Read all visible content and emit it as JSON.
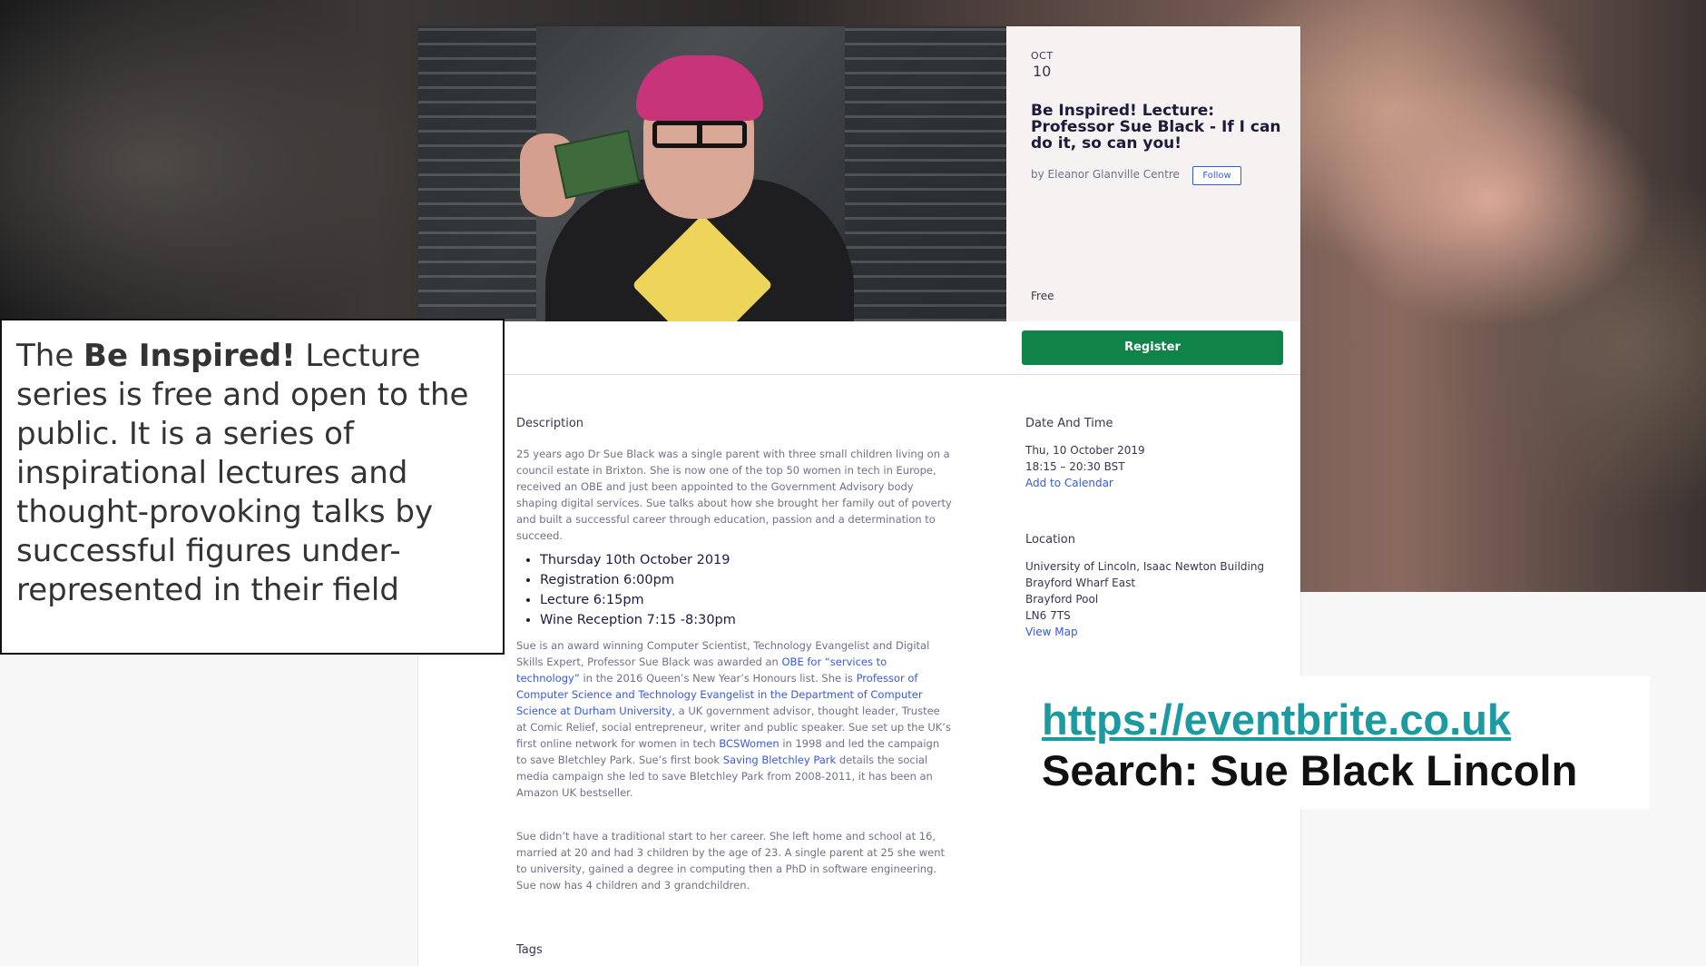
{
  "event": {
    "month": "OCT",
    "day": "10",
    "title": "Be Inspired! Lecture: Professor Sue Black - If I can do it, so can you!",
    "organizer": "by Eleanor Glanville Centre",
    "follow_label": "Follow",
    "price": "Free",
    "register_label": "Register"
  },
  "description": {
    "heading": "Description",
    "intro": "25 years ago Dr Sue Black was a single parent with three small children living on a council estate in Brixton. She is now one of the top 50 women in tech in Europe, received an OBE and just been appointed to the Government Advisory body shaping digital services. Sue talks about how she brought her family out of poverty and built a successful career through education, passion and a determination to succeed.",
    "bullets": [
      "Thursday 10th October 2019",
      "Registration 6:00pm",
      "Lecture 6:15pm",
      "Wine Reception 7:15 -8:30pm"
    ],
    "bio": {
      "t1": "Sue is an award winning Computer Scientist, Technology Evangelist and Digital Skills Expert, Professor Sue Black was awarded an ",
      "l1": "OBE for “services to technology”",
      "t2": " in the 2016 Queen’s New Year’s Honours list. She is ",
      "l2": "Professor of Computer Science and Technology Evangelist in the Department of Computer Science at Durham University",
      "t3": ", a UK government advisor, thought leader, Trustee at Comic Relief, social entrepreneur, writer and public speaker. Sue set up the UK’s first online network for women in tech ",
      "l3": "BCSWomen",
      "t4": " in 1998 and led the campaign to save Bletchley Park. Sue’s first book ",
      "l4": "Saving Bletchley Park",
      "t5": " details the social media campaign she led to save Bletchley Park from 2008-2011, it has been an Amazon UK bestseller."
    },
    "closing": "Sue didn’t have a traditional start to her career. She left home and school at 16, married at 20 and had 3 children by the age of 23. A single parent at 25 she went to university, gained a degree in computing then a PhD in software engineering. Sue now has 4 children and 3 grandchildren.",
    "tags_heading": "Tags"
  },
  "date_time": {
    "heading": "Date And Time",
    "date": "Thu, 10 October 2019",
    "time": "18:15 – 20:30 BST",
    "calendar_link": "Add to Calendar"
  },
  "location": {
    "heading": "Location",
    "lines": [
      "University of Lincoln, Isaac Newton Building",
      "Brayford Wharf East",
      "Brayford Pool",
      "LN6 7TS"
    ],
    "map_link": "View Map"
  },
  "callout": {
    "pre": "The ",
    "bold": "Be Inspired!",
    "post": " Lecture series is free and open to the public. It is a series of inspirational lectures and thought-provoking talks by successful figures under-represented in their field"
  },
  "overlay": {
    "url": "https://eventbrite.co.uk",
    "search": "Search: Sue Black Lincoln"
  },
  "colors": {
    "register_green": "#0f8348",
    "link_blue": "#3659e3",
    "url_teal": "#1b9aa0"
  }
}
